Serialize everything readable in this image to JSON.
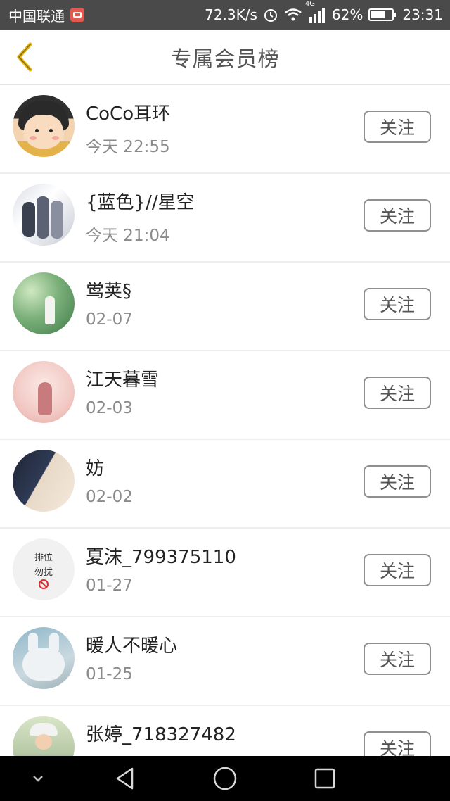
{
  "status_bar": {
    "carrier": "中国联通",
    "net_speed": "72.3K/s",
    "network_type": "4G",
    "battery": "62%",
    "time": "23:31"
  },
  "header": {
    "title": "专属会员榜"
  },
  "members": [
    {
      "name": "CoCo耳环",
      "time": "今天 22:55",
      "follow": "关注"
    },
    {
      "name": "{蓝色}//星空",
      "time": "今天 21:04",
      "follow": "关注"
    },
    {
      "name": "鸴荚§",
      "time": "02-07",
      "follow": "关注"
    },
    {
      "name": "江天暮雪",
      "time": "02-03",
      "follow": "关注"
    },
    {
      "name": "妨",
      "time": "02-02",
      "follow": "关注"
    },
    {
      "name": "夏沫_799375110",
      "time": "01-27",
      "follow": "关注",
      "avatar_text": [
        "排位",
        "勿扰"
      ]
    },
    {
      "name": "暖人不暖心",
      "time": "01-25",
      "follow": "关注"
    },
    {
      "name": "张婷_718327482",
      "time": "",
      "follow": "关注"
    }
  ],
  "colors": {
    "status_bar_bg": "#4a4a4a",
    "back_icon": "#e8b400",
    "nav_bar_bg": "#000000"
  }
}
